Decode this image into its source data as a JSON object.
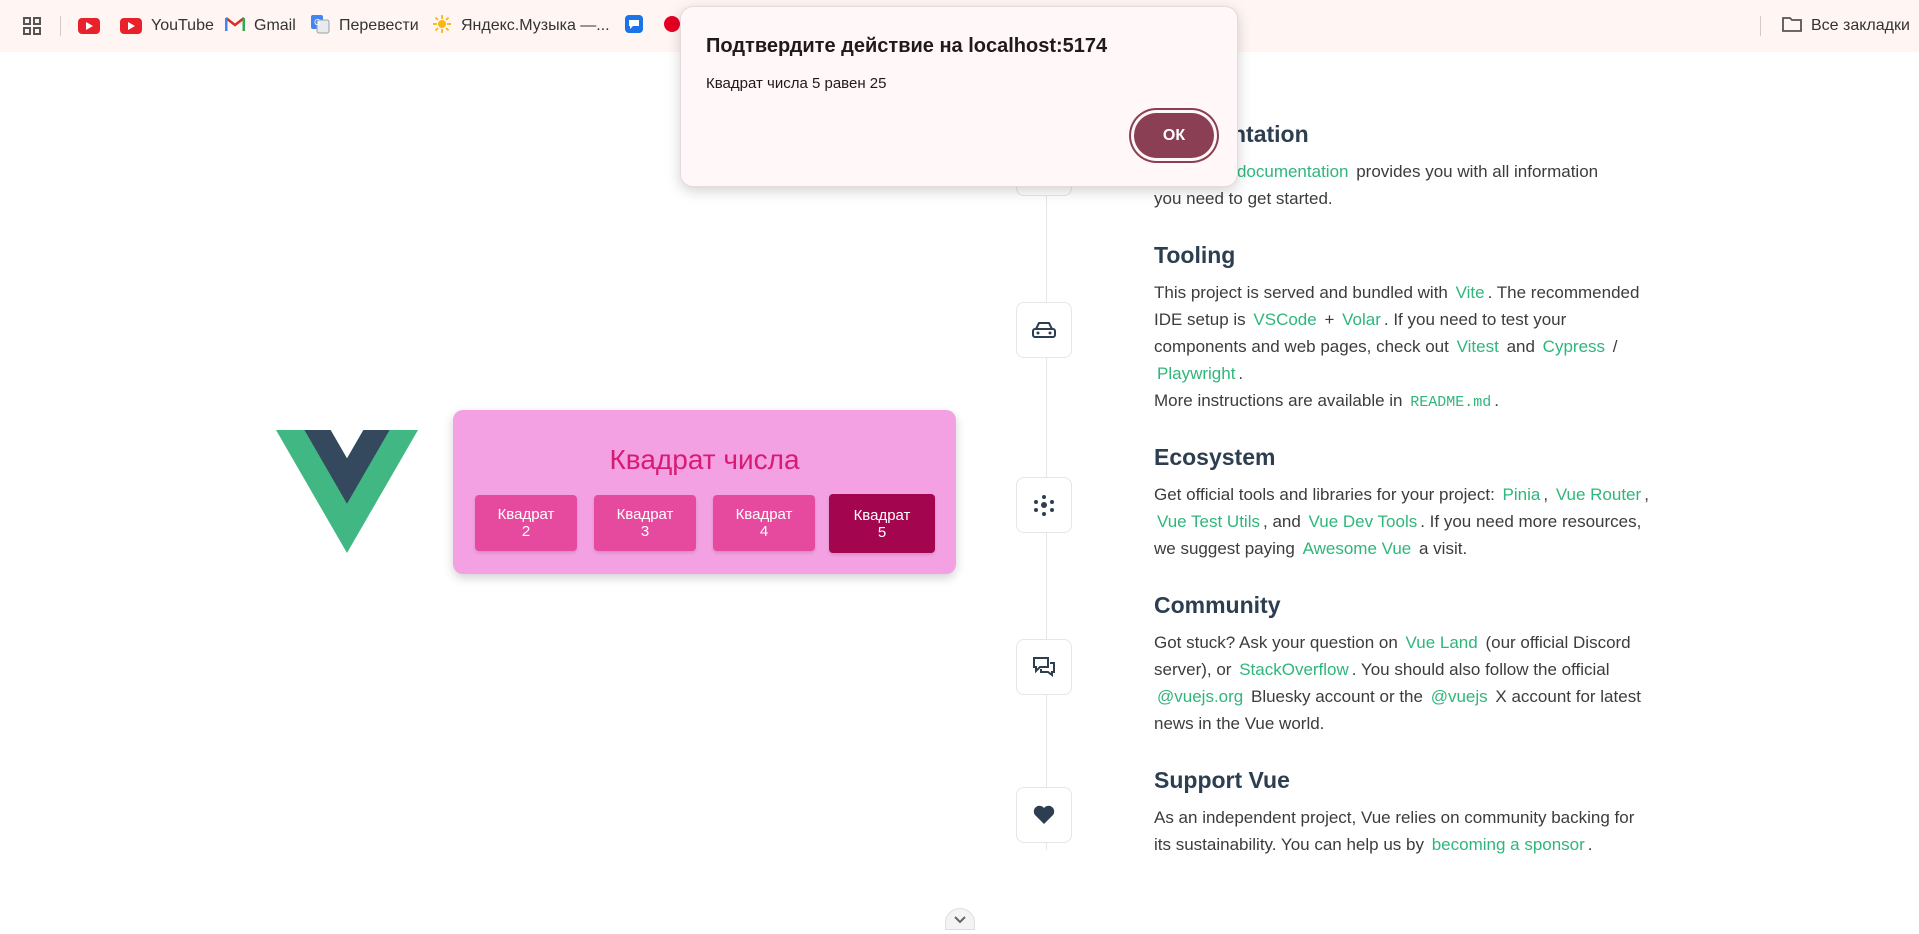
{
  "bookmarks": {
    "youtube_label": "YouTube",
    "gmail_label": "Gmail",
    "translate_label": "Перевести",
    "yandex_music_label": "Яндекс.Музыка —...",
    "all_bookmarks_label": "Все закладки"
  },
  "dialog": {
    "title": "Подтвердите действие на localhost:5174",
    "message": "Квадрат числа 5 равен 25",
    "ok_label": "ОК"
  },
  "card": {
    "title": "Квадрат числа",
    "buttons": [
      {
        "label": "Квадрат",
        "number": "2"
      },
      {
        "label": "Квадрат",
        "number": "3"
      },
      {
        "label": "Квадрат",
        "number": "4"
      },
      {
        "label": "Квадрат",
        "number": "5"
      }
    ]
  },
  "sections": {
    "documentation": {
      "title_partial": "ntation",
      "link_docs": "al documentation",
      "text_1": "provides you with all information",
      "text_2": "you need to get started."
    },
    "tooling": {
      "title": "Tooling",
      "t1": "This project is served and bundled with",
      "vite": "Vite",
      "t2": ". The recommended",
      "t3": "IDE setup is",
      "vscode": "VSCode",
      "plus": "+",
      "volar": "Volar",
      "t4": ". If you need to test your",
      "t5": "components and web pages, check out",
      "vitest": "Vitest",
      "and": "and",
      "cypress": "Cypress",
      "slash": "/",
      "playwright": "Playwright",
      "dot": ".",
      "t6": "More instructions are available in",
      "readme": "README.md",
      "dot2": "."
    },
    "ecosystem": {
      "title": "Ecosystem",
      "t1": "Get official tools and libraries for your project:",
      "pinia": "Pinia",
      "comma1": ",",
      "vue_router": "Vue Router",
      "comma2": ",",
      "vue_test_utils": "Vue Test Utils",
      "and": ", and",
      "vue_dev_tools": "Vue Dev Tools",
      "t2": ". If you need more resources,",
      "t3": "we suggest paying",
      "awesome_vue": "Awesome Vue",
      "t4": "a visit."
    },
    "community": {
      "title": "Community",
      "t1": "Got stuck? Ask your question on",
      "vue_land": "Vue Land",
      "t2": "(our official Discord",
      "t3": "server), or",
      "stackoverflow": "StackOverflow",
      "t4": ". You should also follow the official",
      "vuejs_org": "@vuejs.org",
      "t5": "Bluesky account or the",
      "vuejs": "@vuejs",
      "t6": "X account for latest",
      "t7": "news in the Vue world."
    },
    "support": {
      "title": "Support Vue",
      "t1": "As an independent project, Vue relies on community backing for",
      "t2": "its sustainability. You can help us by",
      "sponsor": "becoming a sponsor",
      "dot": "."
    }
  },
  "colors": {
    "accent_green": "#2fb67a",
    "card_bg": "#f3a1e3",
    "button_pink": "#e64a9f",
    "button_active": "#a3064f",
    "dialog_ok": "#8b3f55"
  }
}
